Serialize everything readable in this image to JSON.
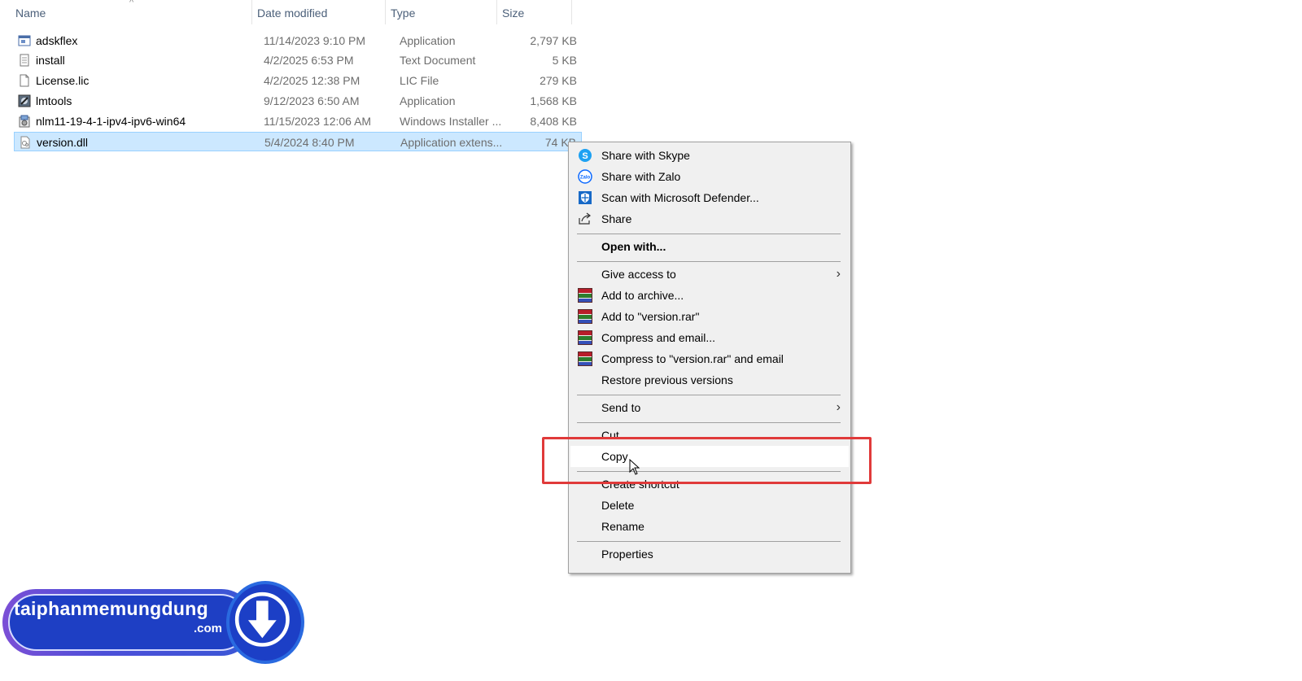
{
  "columns": {
    "name": "Name",
    "date_modified": "Date modified",
    "type": "Type",
    "size": "Size"
  },
  "files": [
    {
      "name": "adskflex",
      "date": "11/14/2023 9:10 PM",
      "type": "Application",
      "size": "2,797 KB",
      "icon": "application-icon"
    },
    {
      "name": "install",
      "date": "4/2/2025 6:53 PM",
      "type": "Text Document",
      "size": "5 KB",
      "icon": "text-document-icon"
    },
    {
      "name": "License.lic",
      "date": "4/2/2025 12:38 PM",
      "type": "LIC File",
      "size": "279 KB",
      "icon": "blank-file-icon"
    },
    {
      "name": "lmtools",
      "date": "9/12/2023 6:50 AM",
      "type": "Application",
      "size": "1,568 KB",
      "icon": "lmtools-app-icon"
    },
    {
      "name": "nlm11-19-4-1-ipv4-ipv6-win64",
      "date": "11/15/2023 12:06 AM",
      "type": "Windows Installer ...",
      "size": "8,408 KB",
      "icon": "installer-icon"
    },
    {
      "name": "version.dll",
      "date": "5/4/2024 8:40 PM",
      "type": "Application extens...",
      "size": "74 KB",
      "icon": "dll-file-icon",
      "selected": true
    }
  ],
  "context_menu": {
    "items": [
      {
        "label": "Share with Skype",
        "icon": "skype-icon"
      },
      {
        "label": "Share with Zalo",
        "icon": "zalo-icon"
      },
      {
        "label": "Scan with Microsoft Defender...",
        "icon": "defender-shield-icon"
      },
      {
        "label": "Share",
        "icon": "share-icon"
      },
      {
        "label": "Open with...",
        "bold": true
      },
      {
        "label": "Give access to",
        "submenu": true
      },
      {
        "label": "Add to archive...",
        "icon": "winrar-icon"
      },
      {
        "label": "Add to \"version.rar\"",
        "icon": "winrar-icon"
      },
      {
        "label": "Compress and email...",
        "icon": "winrar-icon"
      },
      {
        "label": "Compress to \"version.rar\" and email",
        "icon": "winrar-icon"
      },
      {
        "label": "Restore previous versions"
      },
      {
        "label": "Send to",
        "submenu": true
      },
      {
        "label": "Cut"
      },
      {
        "label": "Copy",
        "hovered": true
      },
      {
        "label": "Create shortcut"
      },
      {
        "label": "Delete"
      },
      {
        "label": "Rename"
      },
      {
        "label": "Properties"
      }
    ],
    "submenu_arrow": "›"
  },
  "highlight_color": "#e03a3a",
  "selection_color": "#cce8ff",
  "logo": {
    "brand": "taiphanmemungdung",
    "tld": ".com",
    "icon": "download-arrow-icon"
  }
}
